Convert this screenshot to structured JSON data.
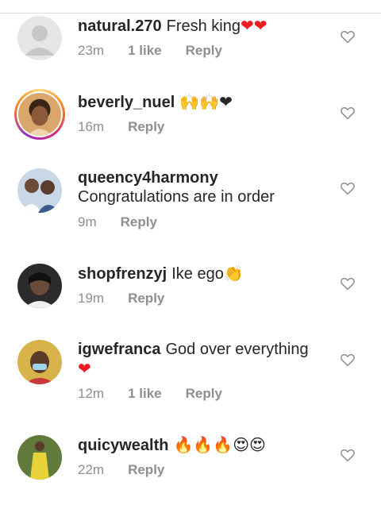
{
  "comments": [
    {
      "username": "natural.270",
      "text": "Fresh king",
      "emoji": "❤❤",
      "time": "23m",
      "likes": "1 like",
      "reply": "Reply",
      "avatar": "default"
    },
    {
      "username": "beverly_nuel",
      "text": "",
      "emoji": "🙌🙌❤",
      "time": "16m",
      "likes": "",
      "reply": "Reply",
      "avatar": "photo-woman-story"
    },
    {
      "username": "queency4harmony",
      "text": "Congratulations are in order",
      "emoji": "",
      "time": "9m",
      "likes": "",
      "reply": "Reply",
      "avatar": "photo-couple"
    },
    {
      "username": "shopfrenzyj",
      "text": "Ike ego",
      "emoji": "👏",
      "time": "19m",
      "likes": "",
      "reply": "Reply",
      "avatar": "photo-woman-dark"
    },
    {
      "username": "igwefranca",
      "text": "God over everything",
      "emoji": "❤",
      "time": "12m",
      "likes": "1 like",
      "reply": "Reply",
      "avatar": "photo-woman-mask"
    },
    {
      "username": "quicywealth",
      "text": "",
      "emoji": "🔥🔥🔥😍😍",
      "time": "22m",
      "likes": "",
      "reply": "Reply",
      "avatar": "photo-woman-dress"
    }
  ],
  "colors": {
    "heart_red": "#ed1c24",
    "meta_gray": "#8e8e8e",
    "text": "#262626"
  }
}
